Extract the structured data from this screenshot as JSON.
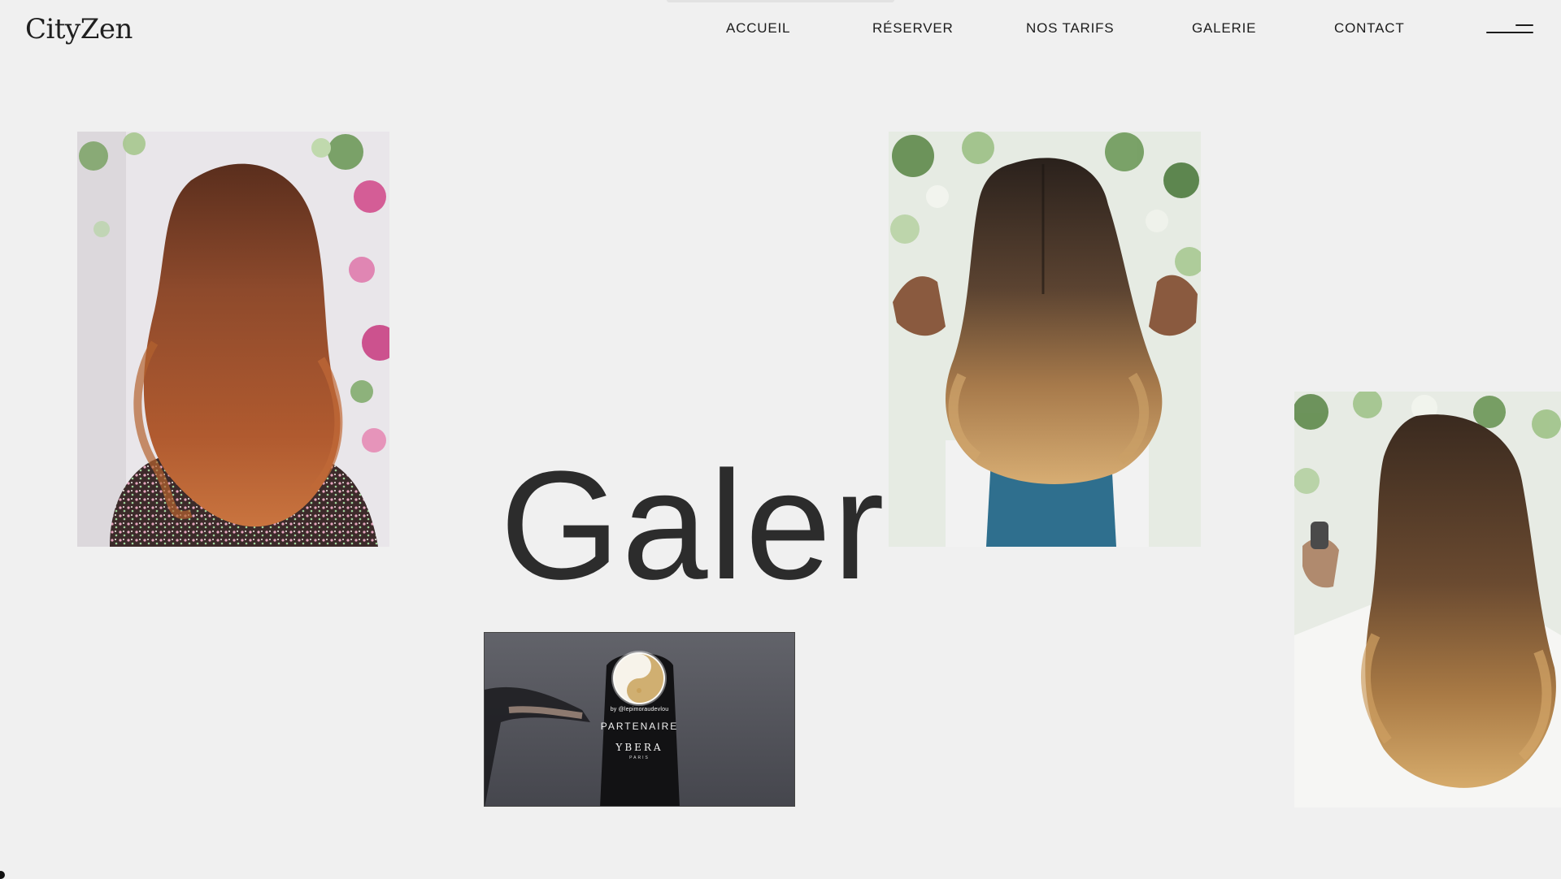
{
  "brand": {
    "logo_text": "CityZen"
  },
  "nav": {
    "items": [
      {
        "label": "ACCUEIL"
      },
      {
        "label": "RÉSERVER"
      },
      {
        "label": "NOS TARIFS"
      },
      {
        "label": "GALERIE"
      },
      {
        "label": "CONTACT"
      }
    ],
    "menu_icon": "hamburger-icon"
  },
  "page": {
    "title": "Galer"
  },
  "video": {
    "byline": "by @lepimoraudevlou",
    "partner_label": "PARTENAIRE",
    "brand_name": "YBERA",
    "brand_sub": "PARIS"
  },
  "colors": {
    "background": "#f0f0f0",
    "text": "#2c2c2c",
    "nav_text": "#1c1c1c"
  }
}
